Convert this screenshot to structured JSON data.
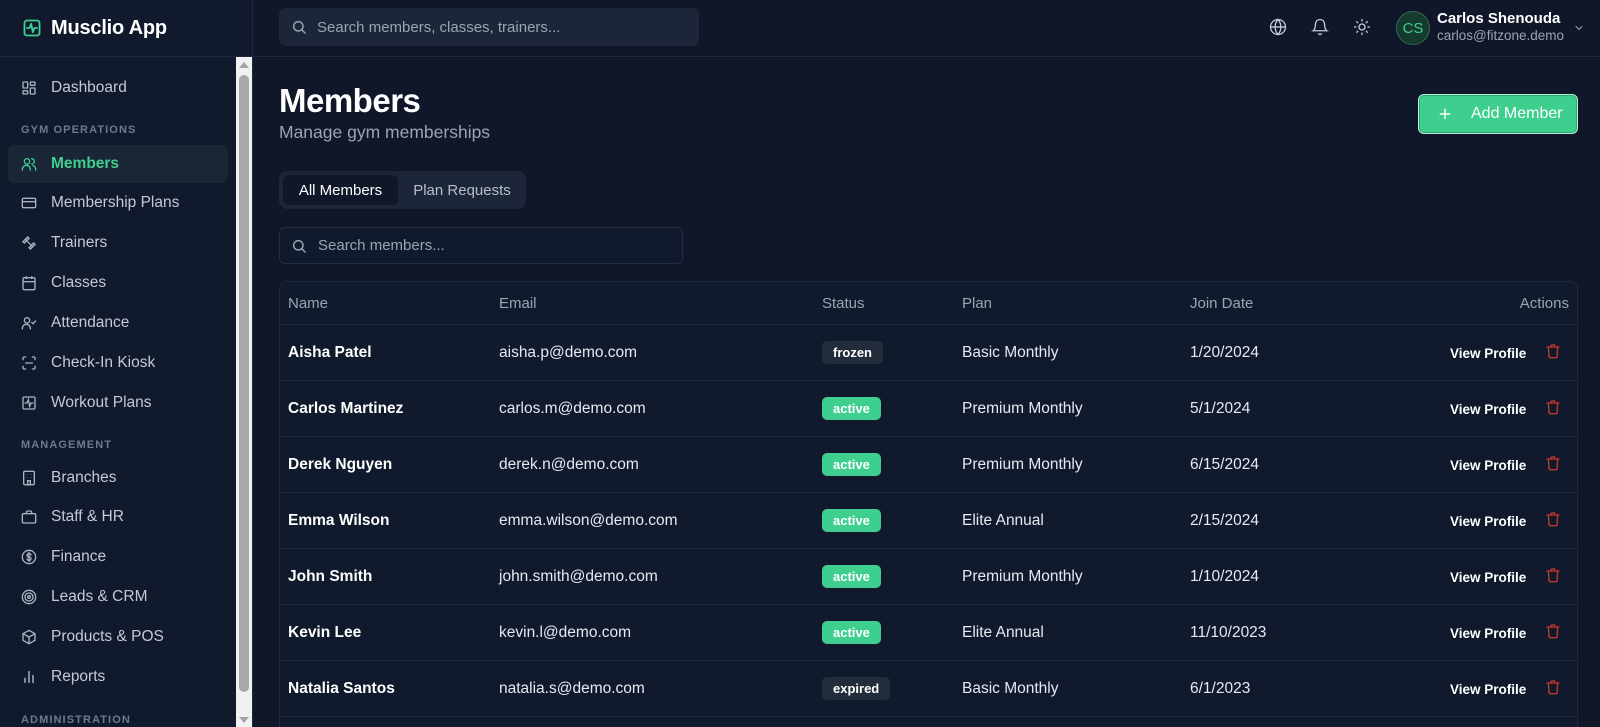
{
  "app": {
    "name": "Musclio App"
  },
  "sidebar": {
    "items": [
      {
        "label": "Dashboard",
        "icon": "dashboard-icon"
      },
      {
        "label": "Members",
        "icon": "users-icon",
        "active": true
      },
      {
        "label": "Membership Plans",
        "icon": "credit-card-icon"
      },
      {
        "label": "Trainers",
        "icon": "dumbbell-icon"
      },
      {
        "label": "Classes",
        "icon": "calendar-icon"
      },
      {
        "label": "Attendance",
        "icon": "user-check-icon"
      },
      {
        "label": "Check-In Kiosk",
        "icon": "scan-icon"
      },
      {
        "label": "Workout Plans",
        "icon": "activity-icon"
      },
      {
        "label": "Branches",
        "icon": "building-icon"
      },
      {
        "label": "Staff & HR",
        "icon": "briefcase-icon"
      },
      {
        "label": "Finance",
        "icon": "dollar-icon"
      },
      {
        "label": "Leads & CRM",
        "icon": "target-icon"
      },
      {
        "label": "Products & POS",
        "icon": "package-icon"
      },
      {
        "label": "Reports",
        "icon": "bar-chart-icon"
      }
    ],
    "sections": [
      "GYM OPERATIONS",
      "MANAGEMENT",
      "ADMINISTRATION"
    ]
  },
  "topbar": {
    "search_placeholder": "Search members, classes, trainers...",
    "user": {
      "initials": "CS",
      "name": "Carlos Shenouda",
      "email": "carlos@fitzone.demo"
    }
  },
  "page": {
    "title": "Members",
    "subtitle": "Manage gym memberships",
    "add_button": "Add Member",
    "tabs": [
      "All Members",
      "Plan Requests"
    ],
    "search_placeholder": "Search members..."
  },
  "table": {
    "headers": [
      "Name",
      "Email",
      "Status",
      "Plan",
      "Join Date",
      "Actions"
    ],
    "view_label": "View Profile",
    "rows": [
      {
        "name": "Aisha Patel",
        "email": "aisha.p@demo.com",
        "status": "frozen",
        "plan": "Basic Monthly",
        "join": "1/20/2024"
      },
      {
        "name": "Carlos Martinez",
        "email": "carlos.m@demo.com",
        "status": "active",
        "plan": "Premium Monthly",
        "join": "5/1/2024"
      },
      {
        "name": "Derek Nguyen",
        "email": "derek.n@demo.com",
        "status": "active",
        "plan": "Premium Monthly",
        "join": "6/15/2024"
      },
      {
        "name": "Emma Wilson",
        "email": "emma.wilson@demo.com",
        "status": "active",
        "plan": "Elite Annual",
        "join": "2/15/2024"
      },
      {
        "name": "John Smith",
        "email": "john.smith@demo.com",
        "status": "active",
        "plan": "Premium Monthly",
        "join": "1/10/2024"
      },
      {
        "name": "Kevin Lee",
        "email": "kevin.l@demo.com",
        "status": "active",
        "plan": "Elite Annual",
        "join": "11/10/2023"
      },
      {
        "name": "Natalia Santos",
        "email": "natalia.s@demo.com",
        "status": "expired",
        "plan": "Basic Monthly",
        "join": "6/1/2023"
      }
    ]
  },
  "colors": {
    "accent": "#3ecf8e",
    "background": "#0f1729",
    "danger": "#c0392b"
  }
}
